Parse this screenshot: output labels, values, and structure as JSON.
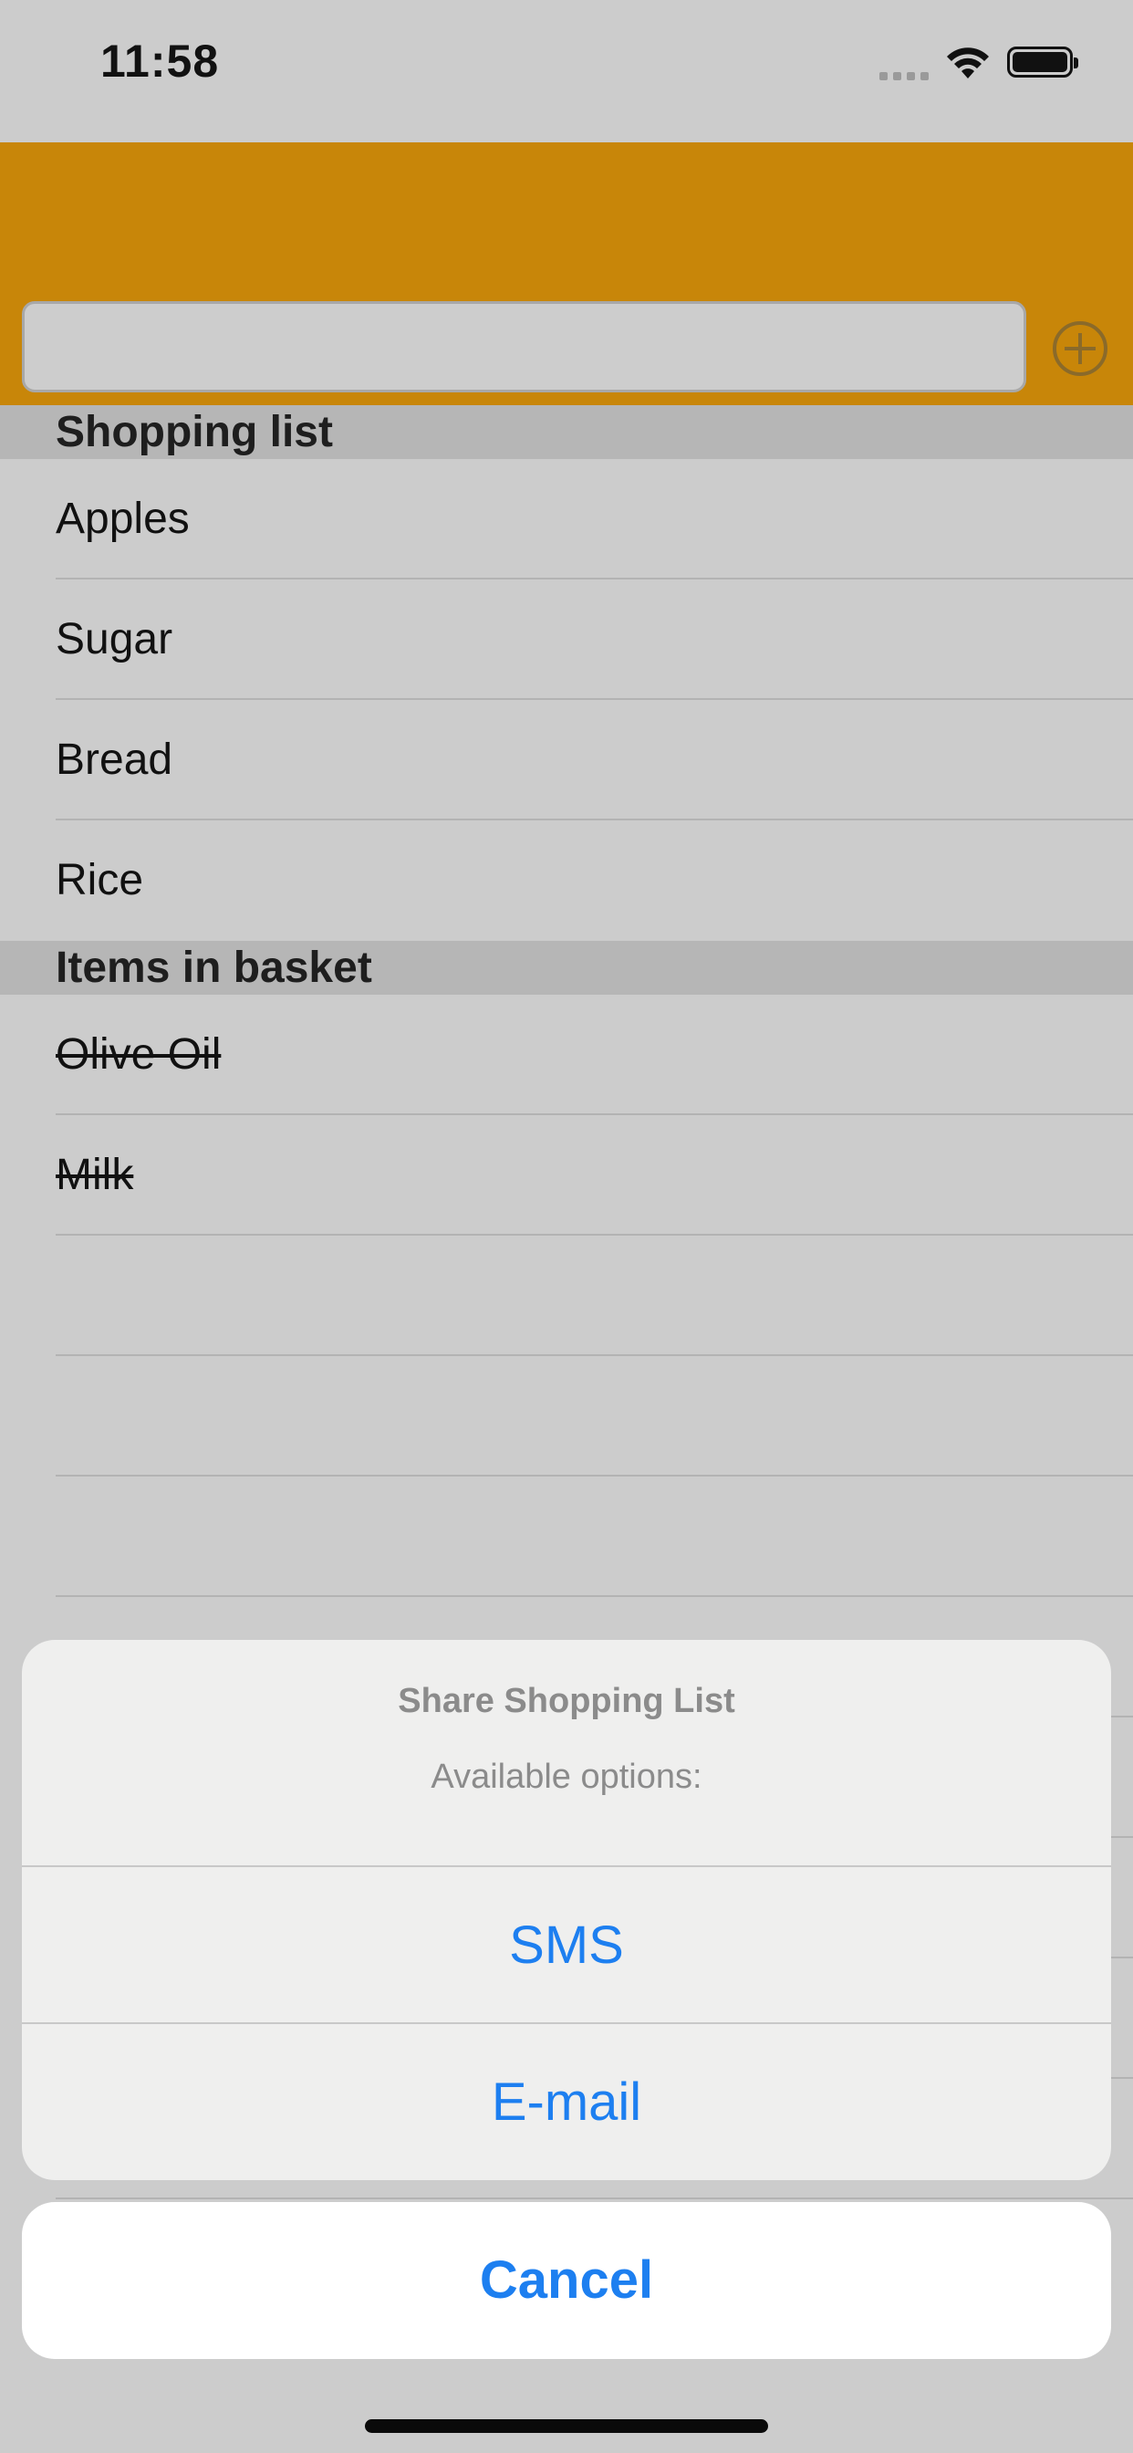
{
  "status_bar": {
    "time": "11:58"
  },
  "header": {
    "new_item_value": "",
    "new_item_placeholder": ""
  },
  "sections": [
    {
      "title": "Shopping list",
      "items": [
        "Apples",
        "Sugar",
        "Bread",
        "Rice"
      ]
    },
    {
      "title": "Items in basket",
      "items": [
        "Olive Oil",
        "Milk"
      ]
    }
  ],
  "action_sheet": {
    "title": "Share Shopping List",
    "message": "Available options:",
    "actions": [
      "SMS",
      "E-mail"
    ],
    "cancel_label": "Cancel"
  },
  "colors": {
    "header_accent": "#c88609",
    "action_blue": "#1d7ff0",
    "background": "#cccccc"
  }
}
